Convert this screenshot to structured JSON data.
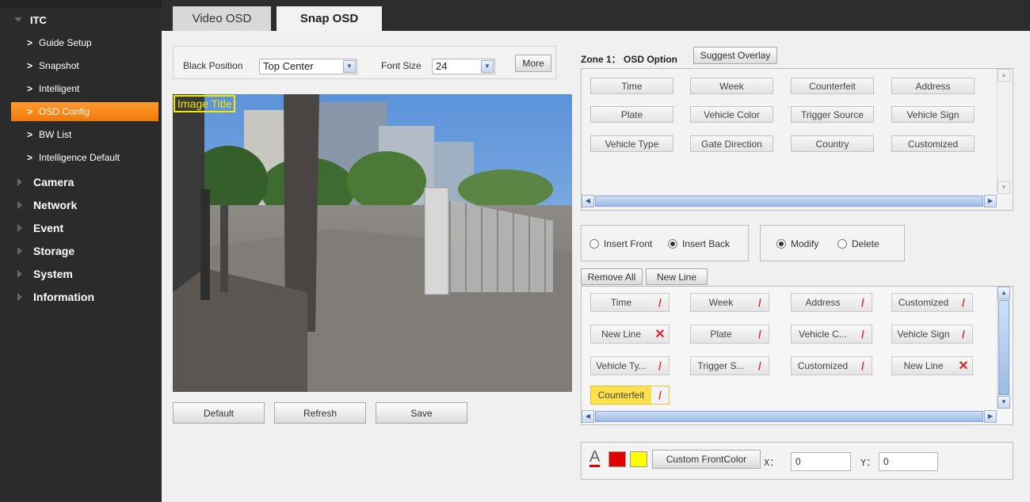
{
  "sidebar": {
    "section_itc": "ITC",
    "items": [
      {
        "label": "Guide Setup"
      },
      {
        "label": "Snapshot"
      },
      {
        "label": "Intelligent"
      },
      {
        "label": "OSD Config"
      },
      {
        "label": "BW List"
      },
      {
        "label": "Intelligence Default"
      }
    ],
    "sections": [
      {
        "label": "Camera"
      },
      {
        "label": "Network"
      },
      {
        "label": "Event"
      },
      {
        "label": "Storage"
      },
      {
        "label": "System"
      },
      {
        "label": "Information"
      }
    ]
  },
  "tabs": [
    {
      "label": "Video OSD"
    },
    {
      "label": "Snap OSD"
    }
  ],
  "position_bar": {
    "black_position_label": "Black Position",
    "black_position_value": "Top Center",
    "font_size_label": "Font Size",
    "font_size_value": "24",
    "more_label": "More"
  },
  "preview": {
    "image_title": "Image Title"
  },
  "actions": {
    "default": "Default",
    "refresh": "Refresh",
    "save": "Save"
  },
  "zone": {
    "title": "Zone 1： OSD Option",
    "suggest_overlay": "Suggest Overlay",
    "options": [
      "Time",
      "Week",
      "Counterfeit",
      "Address",
      "Plate",
      "Vehicle Color",
      "Trigger Source",
      "Vehicle Sign",
      "Vehicle Type",
      "Gate Direction",
      "Country",
      "Customized"
    ]
  },
  "insert_mode": {
    "insert_front": "Insert Front",
    "insert_back": "Insert Back",
    "modify": "Modify",
    "delete": "Delete"
  },
  "list_buttons": {
    "remove_all": "Remove All",
    "new_line": "New Line"
  },
  "selected_items": [
    {
      "label": "Time",
      "action": "edit"
    },
    {
      "label": "Week",
      "action": "edit"
    },
    {
      "label": "Address",
      "action": "edit"
    },
    {
      "label": "Customized",
      "action": "edit"
    },
    {
      "label": "New Line",
      "action": "delete"
    },
    {
      "label": "Plate",
      "action": "edit"
    },
    {
      "label": "Vehicle C...",
      "action": "edit"
    },
    {
      "label": "Vehicle Sign",
      "action": "edit"
    },
    {
      "label": "Vehicle Ty...",
      "action": "edit"
    },
    {
      "label": "Trigger S...",
      "action": "edit"
    },
    {
      "label": "Customized",
      "action": "edit"
    },
    {
      "label": "New Line",
      "action": "delete"
    },
    {
      "label": "Counterfeit",
      "action": "edit",
      "highlighted": true
    }
  ],
  "color_bar": {
    "font_glyph": "A",
    "front_color": "#e00000",
    "back_color": "#ffff00",
    "custom_label": "Custom FrontColor",
    "x_label": "X：",
    "x_value": "0",
    "y_label": "Y：",
    "y_value": "0"
  },
  "colors": {
    "sidebar_bg": "#2b2b2b",
    "active_item": "#f7861c",
    "highlight": "#ffe14c"
  }
}
